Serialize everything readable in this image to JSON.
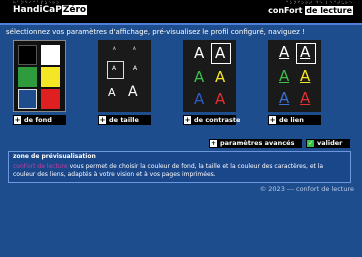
{
  "header": {
    "logo_braille": "⠓⠁⠝⠙⠊⠉⠁⠏⠵⠑⠗⠕",
    "logo_text_a": "HandiCaP",
    "logo_text_b": "Zéro",
    "brand_braille": "⠉⠕⠝⠋⠕⠗⠞ ⠙⠑ ⠇⠑⠉⠞⠥⠗⠑",
    "brand_text_a": "conFort",
    "brand_text_b": "de lecture"
  },
  "instruction": "sélectionnez vos paramètres d'affichage, pré-visualisez le profil configuré, naviguez !",
  "cards": {
    "background": {
      "label": "de fond",
      "swatches": [
        "#000000",
        "#ffffff",
        "#2e9c3c",
        "#f5e625",
        "#1d4d8c",
        "#e02020"
      ]
    },
    "size": {
      "label": "de taille",
      "glyph": "A"
    },
    "contrast": {
      "label": "de contraste",
      "glyph": "A",
      "colors": [
        "#ffffff",
        "#ffffff",
        "#3bbf4a",
        "#f5e625",
        "#2d5bc7",
        "#e03030"
      ]
    },
    "link": {
      "label": "de lien",
      "glyph": "A",
      "colors": [
        "#ffffff",
        "#ffffff",
        "#3bbf4a",
        "#f5e625",
        "#3b6fd4",
        "#e03030"
      ]
    }
  },
  "actions": {
    "advanced_label": "paramètres avancés",
    "validate_label": "valider",
    "validate_color": "#3bbf4a"
  },
  "preview": {
    "title": "zone de prévisualisation",
    "link_text": "conFort de lecture",
    "body_text": " vous permet de choisir la couleur de fond, la taille et la couleur des caractères, et la couleur des liens, adaptés à votre vision et à vos pages imprimées."
  },
  "footer": "© 2023 --- confort de lecture",
  "plus_glyph": "+",
  "check_glyph": "✓"
}
